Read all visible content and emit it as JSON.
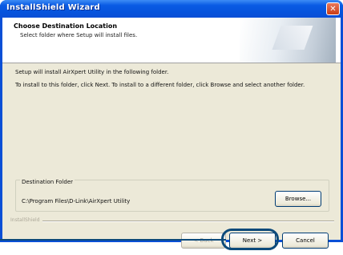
{
  "window": {
    "title": "InstallShield Wizard",
    "close_glyph": "✕"
  },
  "header": {
    "title": "Choose Destination Location",
    "subtitle": "Select folder where Setup will install files."
  },
  "body": {
    "line1": "Setup will install AirXpert Utility in the following folder.",
    "line2": "To install to this folder, click Next. To install to a different folder, click Browse and select another folder."
  },
  "destination": {
    "group_label": "Destination Folder",
    "path": "C:\\Program Files\\D-Link\\AirXpert Utility",
    "browse_label": "Browse..."
  },
  "footer": {
    "label": "InstallShield",
    "back_label": "< Back",
    "next_label": "Next >",
    "cancel_label": "Cancel"
  },
  "colors": {
    "titlebar": "#0a4fd6",
    "callout": "#0d4a7a",
    "dialog_bg": "#ece9d8"
  }
}
